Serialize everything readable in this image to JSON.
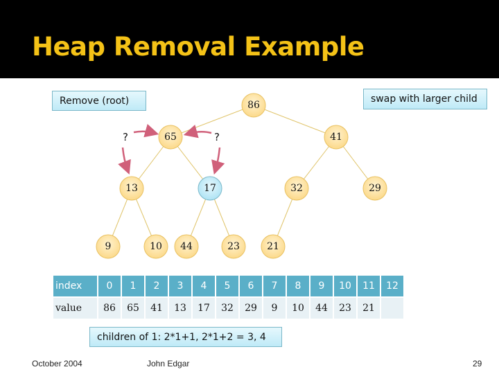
{
  "slide": {
    "title": "Heap Removal Example",
    "callouts": {
      "remove": "Remove (root)",
      "swap": "swap with larger child",
      "children": "children of 1: 2*1+1, 2*1+2 = 3, 4"
    },
    "question_mark": "?",
    "footer": {
      "date": "October 2004",
      "author": "John Edgar",
      "page": "29"
    }
  },
  "colors": {
    "title": "#f4c217",
    "node_fill": "#fde3a0",
    "node_highlight": "#bfeaf7",
    "arrow": "#d0607a",
    "table_header": "#5aafc8",
    "table_cell": "#e8f1f5"
  },
  "tree": {
    "nodes": [
      {
        "id": "n86",
        "value": "86",
        "highlight": false
      },
      {
        "id": "n65",
        "value": "65",
        "highlight": false
      },
      {
        "id": "n41",
        "value": "41",
        "highlight": false
      },
      {
        "id": "n13",
        "value": "13",
        "highlight": false
      },
      {
        "id": "n17",
        "value": "17",
        "highlight": true
      },
      {
        "id": "n32",
        "value": "32",
        "highlight": false
      },
      {
        "id": "n29",
        "value": "29",
        "highlight": false
      },
      {
        "id": "n9",
        "value": "9",
        "highlight": false
      },
      {
        "id": "n10",
        "value": "10",
        "highlight": false
      },
      {
        "id": "n44",
        "value": "44",
        "highlight": false
      },
      {
        "id": "n23",
        "value": "23",
        "highlight": false
      },
      {
        "id": "n21",
        "value": "21",
        "highlight": false
      }
    ],
    "edges": [
      [
        "n86",
        "n65"
      ],
      [
        "n86",
        "n41"
      ],
      [
        "n65",
        "n13"
      ],
      [
        "n65",
        "n17"
      ],
      [
        "n41",
        "n32"
      ],
      [
        "n41",
        "n29"
      ],
      [
        "n13",
        "n9"
      ],
      [
        "n13",
        "n10"
      ],
      [
        "n17",
        "n44"
      ],
      [
        "n17",
        "n23"
      ],
      [
        "n32",
        "n21"
      ]
    ]
  },
  "array_table": {
    "index_label": "index",
    "value_label": "value",
    "indices": [
      "0",
      "1",
      "2",
      "3",
      "4",
      "5",
      "6",
      "7",
      "8",
      "9",
      "10",
      "11",
      "12"
    ],
    "values": [
      "86",
      "65",
      "41",
      "13",
      "17",
      "32",
      "29",
      "9",
      "10",
      "44",
      "23",
      "21",
      ""
    ]
  }
}
